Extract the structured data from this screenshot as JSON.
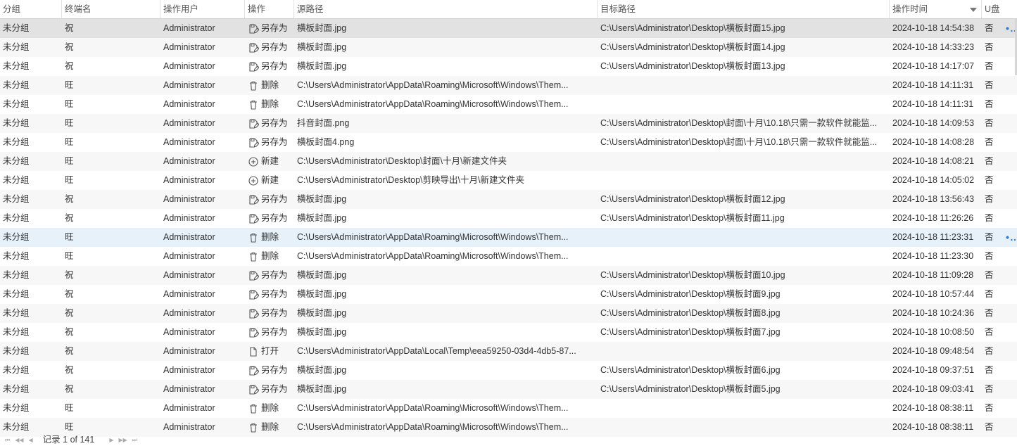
{
  "columns": {
    "group": "分组",
    "terminal": "终端名",
    "user": "操作用户",
    "op": "操作",
    "src": "源路径",
    "dst": "目标路径",
    "time": "操作时间",
    "udisk": "U盘"
  },
  "ops": {
    "saveas": {
      "label": "另存为",
      "icon": "save-as-icon"
    },
    "delete": {
      "label": "删除",
      "icon": "trash-icon"
    },
    "new": {
      "label": "新建",
      "icon": "plus-circle-icon"
    },
    "open": {
      "label": "打开",
      "icon": "file-icon"
    }
  },
  "rows": [
    {
      "group": "未分组",
      "terminal": "祝",
      "user": "Administrator",
      "op": "saveas",
      "op_label": "另存为",
      "src": "横板封面.jpg",
      "dst": "C:\\Users\\Administrator\\Desktop\\横板封面15.jpg",
      "time": "2024-10-18 14:54:38",
      "udisk": "否",
      "state": "selected",
      "more": "•••"
    },
    {
      "group": "未分组",
      "terminal": "祝",
      "user": "Administrator",
      "op": "saveas",
      "op_label": "另存为",
      "src": "横板封面.jpg",
      "dst": "C:\\Users\\Administrator\\Desktop\\横板封面14.jpg",
      "time": "2024-10-18 14:33:23",
      "udisk": "否"
    },
    {
      "group": "未分组",
      "terminal": "祝",
      "user": "Administrator",
      "op": "saveas",
      "op_label": "另存为",
      "src": "横板封面.jpg",
      "dst": "C:\\Users\\Administrator\\Desktop\\横板封面13.jpg",
      "time": "2024-10-18 14:17:07",
      "udisk": "否"
    },
    {
      "group": "未分组",
      "terminal": "旺",
      "user": "Administrator",
      "op": "delete",
      "op_label": "删除",
      "src": "C:\\Users\\Administrator\\AppData\\Roaming\\Microsoft\\Windows\\Them...",
      "dst": "",
      "time": "2024-10-18 14:11:31",
      "udisk": "否"
    },
    {
      "group": "未分组",
      "terminal": "旺",
      "user": "Administrator",
      "op": "delete",
      "op_label": "删除",
      "src": "C:\\Users\\Administrator\\AppData\\Roaming\\Microsoft\\Windows\\Them...",
      "dst": "",
      "time": "2024-10-18 14:11:31",
      "udisk": "否"
    },
    {
      "group": "未分组",
      "terminal": "旺",
      "user": "Administrator",
      "op": "saveas",
      "op_label": "另存为",
      "src": "抖音封面.png",
      "dst": "C:\\Users\\Administrator\\Desktop\\封面\\十月\\10.18\\只需一款软件就能监...",
      "time": "2024-10-18 14:09:53",
      "udisk": "否"
    },
    {
      "group": "未分组",
      "terminal": "旺",
      "user": "Administrator",
      "op": "saveas",
      "op_label": "另存为",
      "src": "横板封面4.png",
      "dst": "C:\\Users\\Administrator\\Desktop\\封面\\十月\\10.18\\只需一款软件就能监...",
      "time": "2024-10-18 14:08:28",
      "udisk": "否"
    },
    {
      "group": "未分组",
      "terminal": "旺",
      "user": "Administrator",
      "op": "new",
      "op_label": "新建",
      "src": "C:\\Users\\Administrator\\Desktop\\封面\\十月\\新建文件夹",
      "dst": "",
      "time": "2024-10-18 14:08:21",
      "udisk": "否"
    },
    {
      "group": "未分组",
      "terminal": "旺",
      "user": "Administrator",
      "op": "new",
      "op_label": "新建",
      "src": "C:\\Users\\Administrator\\Desktop\\剪映导出\\十月\\新建文件夹",
      "dst": "",
      "time": "2024-10-18 14:05:02",
      "udisk": "否"
    },
    {
      "group": "未分组",
      "terminal": "祝",
      "user": "Administrator",
      "op": "saveas",
      "op_label": "另存为",
      "src": "横板封面.jpg",
      "dst": "C:\\Users\\Administrator\\Desktop\\横板封面12.jpg",
      "time": "2024-10-18 13:56:43",
      "udisk": "否"
    },
    {
      "group": "未分组",
      "terminal": "祝",
      "user": "Administrator",
      "op": "saveas",
      "op_label": "另存为",
      "src": "横板封面.jpg",
      "dst": "C:\\Users\\Administrator\\Desktop\\横板封面11.jpg",
      "time": "2024-10-18 11:26:26",
      "udisk": "否"
    },
    {
      "group": "未分组",
      "terminal": "旺",
      "user": "Administrator",
      "op": "delete",
      "op_label": "删除",
      "src": "C:\\Users\\Administrator\\AppData\\Roaming\\Microsoft\\Windows\\Them...",
      "dst": "",
      "time": "2024-10-18 11:23:31",
      "udisk": "否",
      "state": "hover",
      "more": "•••"
    },
    {
      "group": "未分组",
      "terminal": "旺",
      "user": "Administrator",
      "op": "delete",
      "op_label": "删除",
      "src": "C:\\Users\\Administrator\\AppData\\Roaming\\Microsoft\\Windows\\Them...",
      "dst": "",
      "time": "2024-10-18 11:23:30",
      "udisk": "否"
    },
    {
      "group": "未分组",
      "terminal": "祝",
      "user": "Administrator",
      "op": "saveas",
      "op_label": "另存为",
      "src": "横板封面.jpg",
      "dst": "C:\\Users\\Administrator\\Desktop\\横板封面10.jpg",
      "time": "2024-10-18 11:09:28",
      "udisk": "否"
    },
    {
      "group": "未分组",
      "terminal": "祝",
      "user": "Administrator",
      "op": "saveas",
      "op_label": "另存为",
      "src": "横板封面.jpg",
      "dst": "C:\\Users\\Administrator\\Desktop\\横板封面9.jpg",
      "time": "2024-10-18 10:57:44",
      "udisk": "否"
    },
    {
      "group": "未分组",
      "terminal": "祝",
      "user": "Administrator",
      "op": "saveas",
      "op_label": "另存为",
      "src": "横板封面.jpg",
      "dst": "C:\\Users\\Administrator\\Desktop\\横板封面8.jpg",
      "time": "2024-10-18 10:24:36",
      "udisk": "否"
    },
    {
      "group": "未分组",
      "terminal": "祝",
      "user": "Administrator",
      "op": "saveas",
      "op_label": "另存为",
      "src": "横板封面.jpg",
      "dst": "C:\\Users\\Administrator\\Desktop\\横板封面7.jpg",
      "time": "2024-10-18 10:08:50",
      "udisk": "否"
    },
    {
      "group": "未分组",
      "terminal": "祝",
      "user": "Administrator",
      "op": "open",
      "op_label": "打开",
      "src": "C:\\Users\\Administrator\\AppData\\Local\\Temp\\eea59250-03d4-4db5-87...",
      "dst": "",
      "time": "2024-10-18 09:48:54",
      "udisk": "否"
    },
    {
      "group": "未分组",
      "terminal": "祝",
      "user": "Administrator",
      "op": "saveas",
      "op_label": "另存为",
      "src": "横板封面.jpg",
      "dst": "C:\\Users\\Administrator\\Desktop\\横板封面6.jpg",
      "time": "2024-10-18 09:37:51",
      "udisk": "否"
    },
    {
      "group": "未分组",
      "terminal": "祝",
      "user": "Administrator",
      "op": "saveas",
      "op_label": "另存为",
      "src": "横板封面.jpg",
      "dst": "C:\\Users\\Administrator\\Desktop\\横板封面5.jpg",
      "time": "2024-10-18 09:03:41",
      "udisk": "否"
    },
    {
      "group": "未分组",
      "terminal": "旺",
      "user": "Administrator",
      "op": "delete",
      "op_label": "删除",
      "src": "C:\\Users\\Administrator\\AppData\\Roaming\\Microsoft\\Windows\\Them...",
      "dst": "",
      "time": "2024-10-18 08:38:11",
      "udisk": "否"
    },
    {
      "group": "未分组",
      "terminal": "旺",
      "user": "Administrator",
      "op": "delete",
      "op_label": "删除",
      "src": "C:\\Users\\Administrator\\AppData\\Roaming\\Microsoft\\Windows\\Them...",
      "dst": "",
      "time": "2024-10-18 08:38:11",
      "udisk": "否"
    }
  ],
  "pager": {
    "first": "⏮",
    "prev_fast": "◀◀",
    "prev": "◀",
    "record_text": "记录 1 of 141",
    "next": "▶",
    "next_fast": "▶▶",
    "last": "⏭"
  },
  "colors": {
    "selected_row": "#e2e2e2",
    "hover_row": "#e6f1fa",
    "alt_row": "#f7f7f7",
    "more_dots": "#2a7ac9"
  }
}
